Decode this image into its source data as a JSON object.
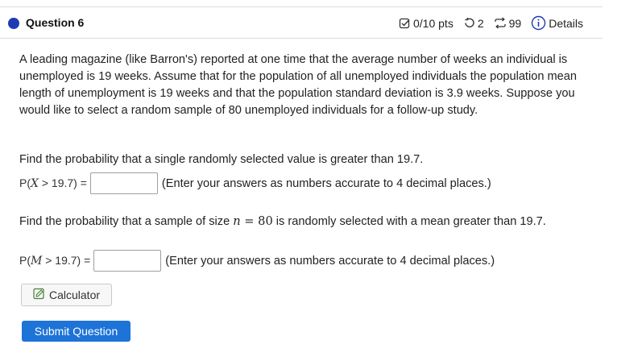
{
  "question": {
    "title": "Question 6",
    "score": "0/10 pts",
    "retries": "2",
    "attempts": "99",
    "details_label": "Details"
  },
  "problem_text": "A leading magazine (like Barron's) reported at one time that the average number of weeks an individual is unemployed is 19 weeks. Assume that for the population of all unemployed individuals the population mean length of unemployment is 19 weeks and that the population standard deviation is 3.9 weeks. Suppose you would like to select a random sample of 80 unemployed individuals for a follow-up study.",
  "part1": {
    "prompt": "Find the probability that a single randomly selected value is greater than 19.7.",
    "label_prefix": "P(",
    "label_var": "X",
    "label_suffix": " > 19.7) =",
    "answer_value": "",
    "hint": "(Enter your answers as numbers accurate to 4 decimal places.)"
  },
  "part2": {
    "prompt_before": "Find the probability that a sample of size ",
    "n_var": "n",
    "n_eq": " = 80",
    "prompt_after": " is randomly selected with a mean greater than 19.7.",
    "label_prefix": "P(",
    "label_var": "M",
    "label_suffix": " > 19.7) =",
    "answer_value": "",
    "hint": "(Enter your answers as numbers accurate to 4 decimal places.)"
  },
  "buttons": {
    "calculator": "Calculator",
    "submit": "Submit Question"
  },
  "colors": {
    "accent": "#1f3bb3",
    "submit": "#1e73d8"
  },
  "icons": {
    "score": "checkbox-edit-icon",
    "retries": "retry-icon",
    "attempts": "repeat-icon",
    "details": "info-circle-icon",
    "calculator": "pencil-square-icon"
  }
}
